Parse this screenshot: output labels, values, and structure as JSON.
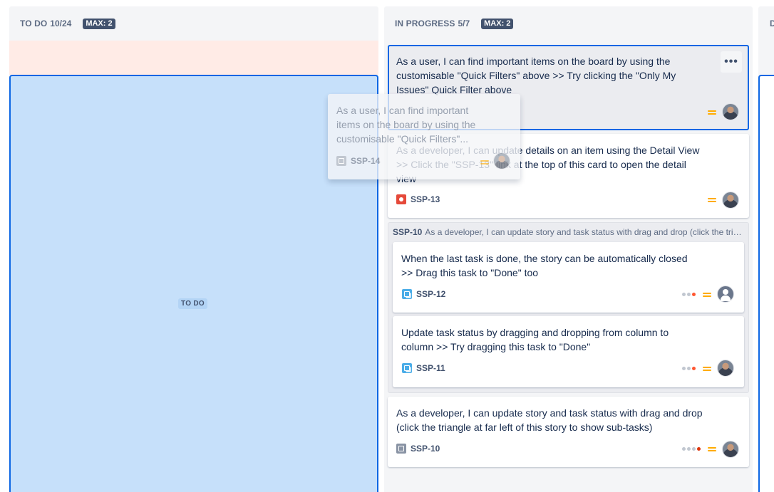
{
  "columns": {
    "todo": {
      "title": "TO DO",
      "count": "10/24",
      "max": "MAX: 2",
      "drop_label": "TO DO"
    },
    "in_progress": {
      "title": "IN PROGRESS",
      "count": "5/7",
      "max": "MAX: 2"
    },
    "done": {
      "title": "D"
    }
  },
  "cards": {
    "ssp14": {
      "summary_line1": "As a user, I can find important items on the board by using the",
      "summary_line2": "customisable \"Quick Filters\" above >> Try clicking the \"Only My",
      "summary_line3": "Issues\" Quick Filter above",
      "more": "•••"
    },
    "ssp13": {
      "summary_line1": "As a developer, I can update details on an item using the Detail View",
      "summary_line2": ">> Click the \"SSP-13\" link at the top of this card to open the detail",
      "summary_line3": "view",
      "key": "SSP-13"
    },
    "ssp10_group": {
      "key": "SSP-10",
      "summary": "As a developer, I can update story and task status with drag and drop (click the triangle at far left of this story to show sub-tasks)"
    },
    "ssp12": {
      "summary_line1": "When the last task is done, the story can be automatically closed",
      "summary_line2": ">> Drag this task to \"Done\" too",
      "key": "SSP-12"
    },
    "ssp11": {
      "summary_line1": "Update task status by dragging and dropping from column to",
      "summary_line2": "column >> Try dragging this task to \"Done\"",
      "key": "SSP-11"
    },
    "ssp10": {
      "summary_line1": "As a developer, I can update story and task status with drag and drop",
      "summary_line2": "(click the triangle at far left of this story to show sub-tasks)",
      "key": "SSP-10"
    },
    "ghost": {
      "summary_line1": "As a user, I can find important",
      "summary_line2": "items on the board by using the",
      "summary_line3": "customisable \"Quick Filters\"...",
      "key": "SSP-14"
    }
  },
  "colors": {
    "drop_zone": "#c6e0fa",
    "drop_border": "#0c66e4",
    "warn_band": "#ffebe6",
    "priority_medium": "#ffab00",
    "selected_border": "#0c66e4"
  }
}
